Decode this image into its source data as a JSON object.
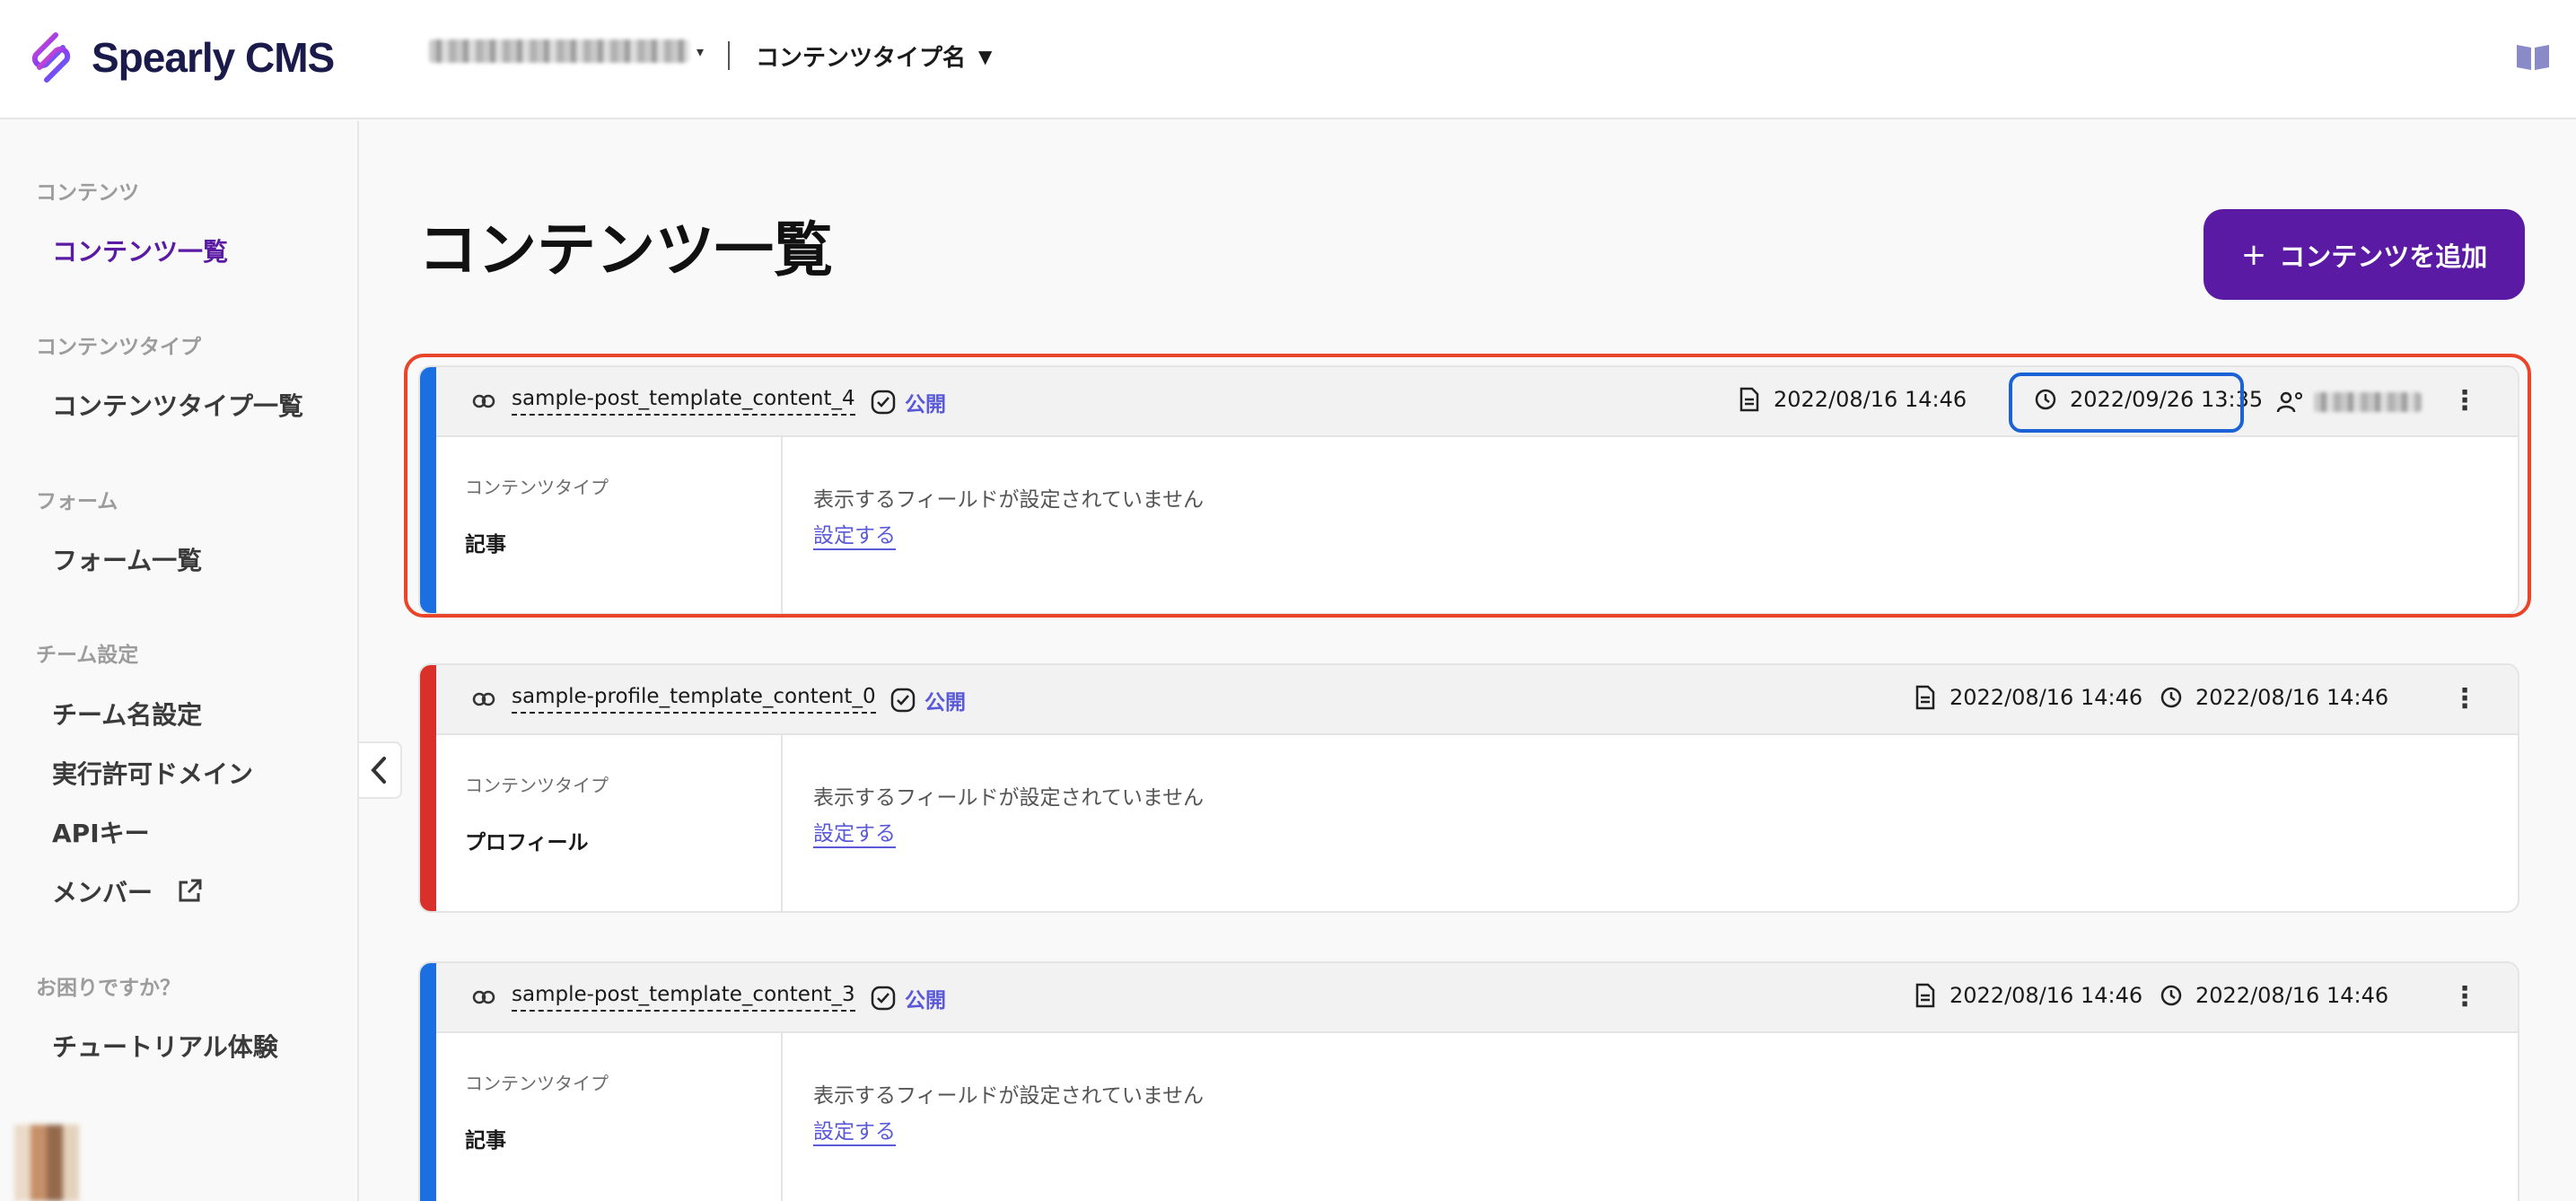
{
  "header": {
    "app_name": "Spearly CMS",
    "content_type_name": "コンテンツタイプ名"
  },
  "sidebar": {
    "sections": [
      {
        "title": "コンテンツ",
        "items": [
          {
            "label": "コンテンツ一覧",
            "active": true
          }
        ]
      },
      {
        "title": "コンテンツタイプ",
        "items": [
          {
            "label": "コンテンツタイプ一覧"
          }
        ]
      },
      {
        "title": "フォーム",
        "items": [
          {
            "label": "フォーム一覧"
          }
        ]
      },
      {
        "title": "チーム設定",
        "items": [
          {
            "label": "チーム名設定"
          },
          {
            "label": "実行許可ドメイン"
          },
          {
            "label": "APIキー"
          },
          {
            "label": "メンバー",
            "icon": "external-link-icon"
          }
        ]
      },
      {
        "title": "お困りですか？",
        "items": [
          {
            "label": "チュートリアル体験"
          }
        ]
      }
    ]
  },
  "main": {
    "title": "コンテンツ一覧",
    "add_button_label": "コンテンツを追加",
    "content_type_label": "コンテンツタイプ",
    "no_fields_message": "表示するフィールドが設定されていません",
    "configure_link": "設定する",
    "status_published": "公開",
    "cards": [
      {
        "slug": "sample-post_template_content_4",
        "status": "公開",
        "created": "2022/08/16 14:46",
        "updated": "2022/09/26 13:35",
        "content_type": "記事",
        "stripe_color": "#1b6fe0"
      },
      {
        "slug": "sample-profile_template_content_0",
        "status": "公開",
        "created": "2022/08/16 14:46",
        "updated": "2022/08/16 14:46",
        "content_type": "プロフィール",
        "stripe_color": "#d9302a"
      },
      {
        "slug": "sample-post_template_content_3",
        "status": "公開",
        "created": "2022/08/16 14:46",
        "updated": "2022/08/16 14:46",
        "content_type": "記事",
        "stripe_color": "#1b6fe0"
      }
    ]
  },
  "colors": {
    "brand": "#5a1aa3",
    "link": "#5a5ad8",
    "highlight_orange": "#e8452a",
    "highlight_blue": "#1b62d6"
  }
}
